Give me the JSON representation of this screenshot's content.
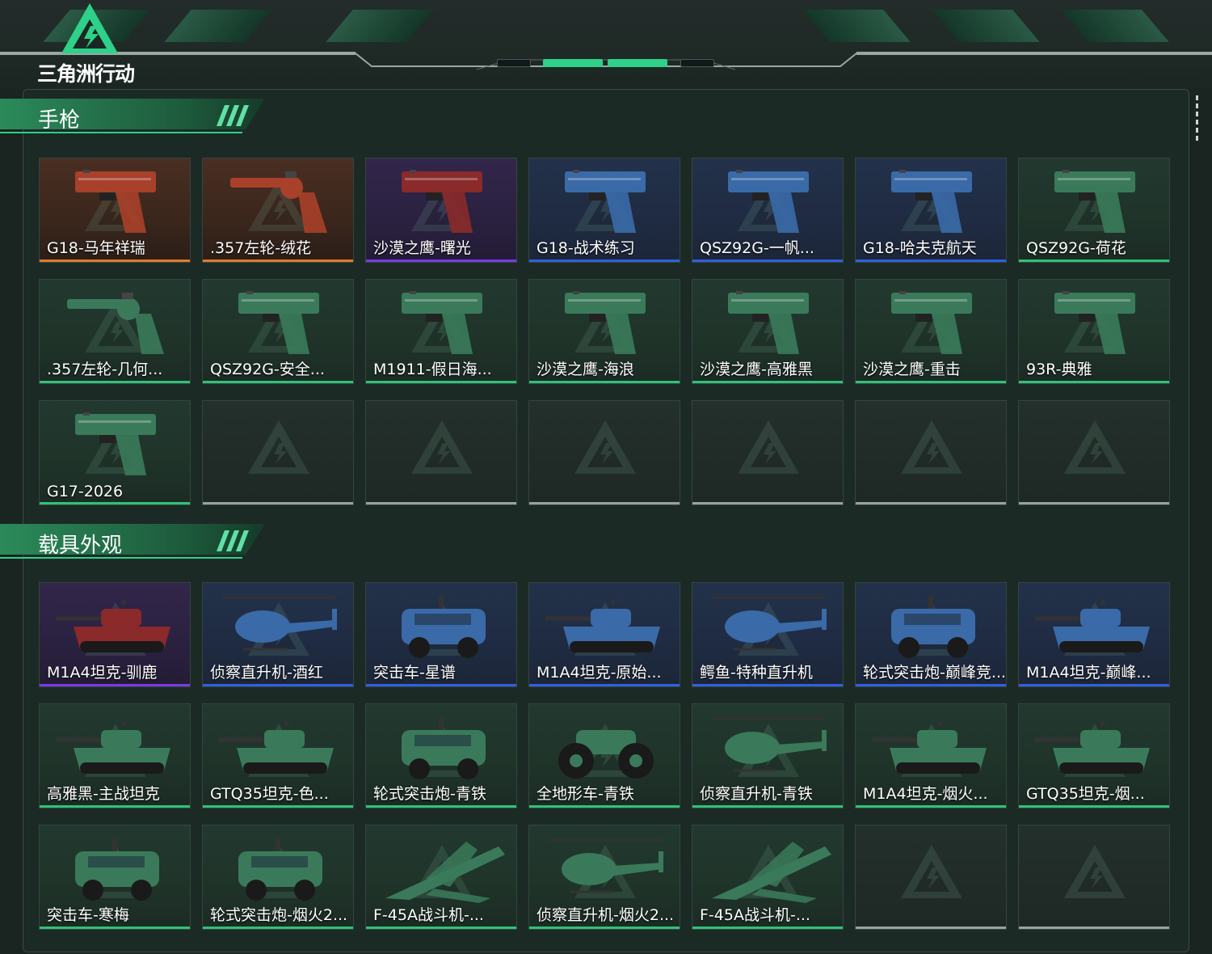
{
  "brand": {
    "name": "三角洲行动",
    "accent": "#2ed08a"
  },
  "rarity_colors": {
    "orange": "#e07a2a",
    "purple": "#7a3ae6",
    "blue": "#2f5fe0",
    "green": "#2fc278",
    "grey": "#9aa19e"
  },
  "sections": [
    {
      "title": "手枪",
      "items": [
        {
          "name": "G18-马年祥瑞",
          "rarity": "orange",
          "icon": "pistol-icon"
        },
        {
          "name": ".357左轮-绒花",
          "rarity": "orange",
          "icon": "revolver-icon"
        },
        {
          "name": "沙漠之鹰-曙光",
          "rarity": "purple",
          "icon": "pistol-icon"
        },
        {
          "name": "G18-战术练习",
          "rarity": "blue",
          "icon": "pistol-icon"
        },
        {
          "name": "QSZ92G-一帆...",
          "rarity": "blue",
          "icon": "pistol-icon"
        },
        {
          "name": "G18-哈夫克航天",
          "rarity": "blue",
          "icon": "pistol-icon"
        },
        {
          "name": "QSZ92G-荷花",
          "rarity": "green",
          "icon": "pistol-icon"
        },
        {
          "name": ".357左轮-几何...",
          "rarity": "green",
          "icon": "revolver-icon"
        },
        {
          "name": "QSZ92G-安全...",
          "rarity": "green",
          "icon": "pistol-icon"
        },
        {
          "name": "M1911-假日海...",
          "rarity": "green",
          "icon": "pistol-icon"
        },
        {
          "name": "沙漠之鹰-海浪",
          "rarity": "green",
          "icon": "pistol-icon"
        },
        {
          "name": "沙漠之鹰-高雅黑",
          "rarity": "green",
          "icon": "pistol-icon"
        },
        {
          "name": "沙漠之鹰-重击",
          "rarity": "green",
          "icon": "pistol-icon"
        },
        {
          "name": "93R-典雅",
          "rarity": "green",
          "icon": "pistol-icon"
        },
        {
          "name": "G17-2026",
          "rarity": "green",
          "icon": "pistol-icon"
        },
        {
          "name": "",
          "rarity": "grey",
          "icon": ""
        },
        {
          "name": "",
          "rarity": "grey",
          "icon": ""
        },
        {
          "name": "",
          "rarity": "grey",
          "icon": ""
        },
        {
          "name": "",
          "rarity": "grey",
          "icon": ""
        },
        {
          "name": "",
          "rarity": "grey",
          "icon": ""
        },
        {
          "name": "",
          "rarity": "grey",
          "icon": ""
        }
      ]
    },
    {
      "title": "载具外观",
      "items": [
        {
          "name": "M1A4坦克-驯鹿",
          "rarity": "purple",
          "icon": "tank-icon"
        },
        {
          "name": "侦察直升机-酒红",
          "rarity": "blue",
          "icon": "helicopter-icon"
        },
        {
          "name": "突击车-星谱",
          "rarity": "blue",
          "icon": "armored-car-icon"
        },
        {
          "name": "M1A4坦克-原始...",
          "rarity": "blue",
          "icon": "tank-icon"
        },
        {
          "name": "鳄鱼-特种直升机",
          "rarity": "blue",
          "icon": "helicopter-icon"
        },
        {
          "name": "轮式突击炮-巅峰竞...",
          "rarity": "blue",
          "icon": "armored-car-icon"
        },
        {
          "name": "M1A4坦克-巅峰...",
          "rarity": "blue",
          "icon": "tank-icon"
        },
        {
          "name": "高雅黑-主战坦克",
          "rarity": "green",
          "icon": "tank-icon"
        },
        {
          "name": "GTQ35坦克-色...",
          "rarity": "green",
          "icon": "tank-icon"
        },
        {
          "name": "轮式突击炮-青铁",
          "rarity": "green",
          "icon": "armored-car-icon"
        },
        {
          "name": "全地形车-青铁",
          "rarity": "green",
          "icon": "atv-icon"
        },
        {
          "name": "侦察直升机-青铁",
          "rarity": "green",
          "icon": "helicopter-icon"
        },
        {
          "name": "M1A4坦克-烟火...",
          "rarity": "green",
          "icon": "tank-icon"
        },
        {
          "name": "GTQ35坦克-烟...",
          "rarity": "green",
          "icon": "tank-icon"
        },
        {
          "name": "突击车-寒梅",
          "rarity": "green",
          "icon": "armored-car-icon"
        },
        {
          "name": "轮式突击炮-烟火2...",
          "rarity": "green",
          "icon": "armored-car-icon"
        },
        {
          "name": "F-45A战斗机-...",
          "rarity": "green",
          "icon": "fighter-jet-icon"
        },
        {
          "name": "侦察直升机-烟火2...",
          "rarity": "green",
          "icon": "helicopter-icon"
        },
        {
          "name": "F-45A战斗机-...",
          "rarity": "green",
          "icon": "fighter-jet-icon"
        },
        {
          "name": "",
          "rarity": "grey",
          "icon": ""
        },
        {
          "name": "",
          "rarity": "grey",
          "icon": ""
        }
      ]
    }
  ]
}
